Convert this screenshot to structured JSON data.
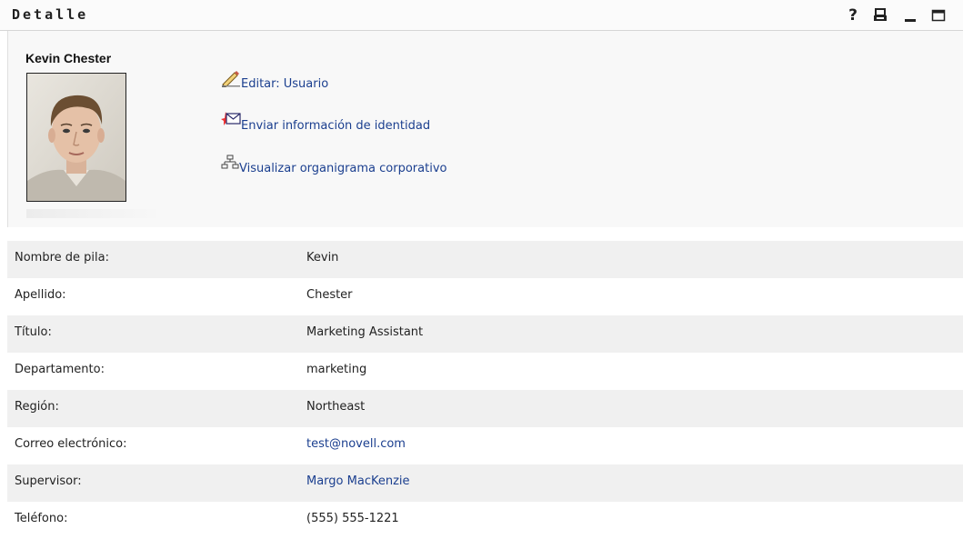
{
  "portlet": {
    "title": "Detalle",
    "help_label": "?"
  },
  "user": {
    "name": "Kevin Chester"
  },
  "actions": [
    {
      "label": "Editar: Usuario",
      "icon": "pencil-icon"
    },
    {
      "label": "Enviar información de identidad",
      "icon": "envelope-icon"
    },
    {
      "label": "Visualizar organigrama corporativo",
      "icon": "org-chart-icon"
    }
  ],
  "fields": [
    {
      "label": "Nombre de pila:",
      "value": "Kevin"
    },
    {
      "label": "Apellido:",
      "value": "Chester"
    },
    {
      "label": "Título:",
      "value": "Marketing Assistant"
    },
    {
      "label": "Departamento:",
      "value": "marketing"
    },
    {
      "label": "Región:",
      "value": "Northeast"
    },
    {
      "label": "Correo electrónico:",
      "value": "test@novell.com"
    },
    {
      "label": "Supervisor:",
      "value": "Margo MacKenzie"
    },
    {
      "label": "Teléfono:",
      "value": "(555) 555-1221"
    }
  ],
  "colors": {
    "link": "#1b3f8f",
    "row_alt": "#f0f0f0"
  }
}
